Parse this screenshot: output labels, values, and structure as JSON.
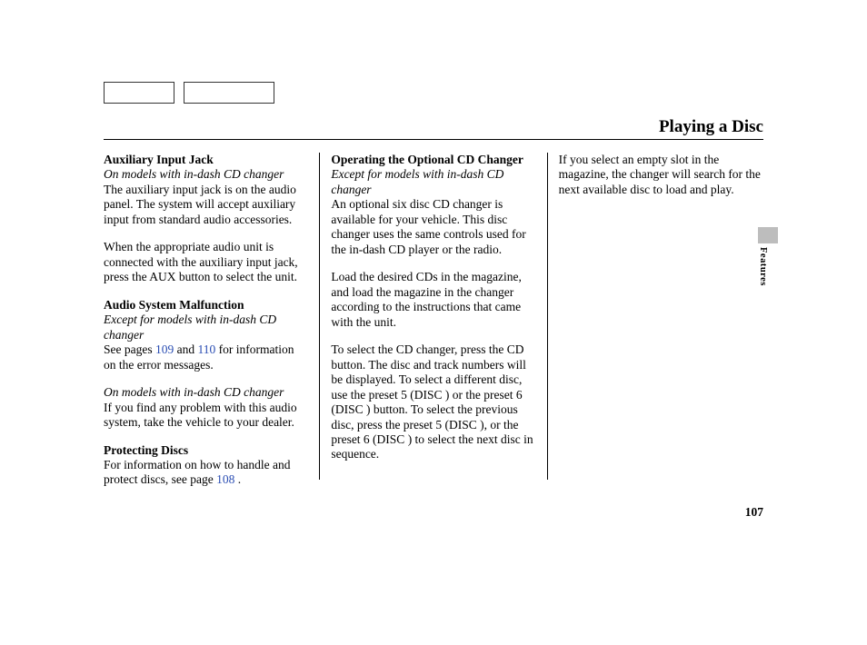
{
  "title": "Playing a Disc",
  "side_tab": "Features",
  "page_number": "107",
  "col1": {
    "aux": {
      "head": "Auxiliary Input Jack",
      "note": "On models with in-dash CD changer",
      "p1": "The auxiliary input jack is on the audio panel. The system will accept auxiliary input from standard audio accessories.",
      "p2": "When the appropriate audio unit is connected with the auxiliary input jack, press the AUX button to select the unit."
    },
    "malf": {
      "head": "Audio System Malfunction",
      "note": "Except for models with in-dash CD changer",
      "p1a": "See pages ",
      "link1": "109",
      "p1b": " and ",
      "link2": "110",
      "p1c": " for information on the error messages.",
      "note2": "On models with in-dash CD changer",
      "p2": "If you find any problem with this audio system, take the vehicle to your dealer."
    },
    "protect": {
      "head": "Protecting Discs",
      "p1a": "For information on how to handle and protect discs, see page ",
      "link1": "108",
      "p1b": " ."
    }
  },
  "col2": {
    "opt": {
      "head": "Operating the Optional CD Changer",
      "note": "Except for models with in-dash CD changer",
      "p1": "An optional six disc CD changer is available for your vehicle. This disc changer uses the same controls used for the in-dash CD player or the radio.",
      "p2": "Load the desired CDs in the magazine, and load the magazine in the changer according to the instructions that came with the unit.",
      "p3": "To select the CD changer, press the CD button. The disc and track numbers will be displayed. To select a different disc, use the preset 5 (DISC     ) or the preset 6 (DISC     ) button. To select the previous disc, press the preset 5 (DISC     ), or the preset 6 (DISC     ) to select the next disc in sequence."
    }
  },
  "col3": {
    "p1": "If you select an empty slot in the magazine, the changer will search for the next available disc to load and play."
  }
}
